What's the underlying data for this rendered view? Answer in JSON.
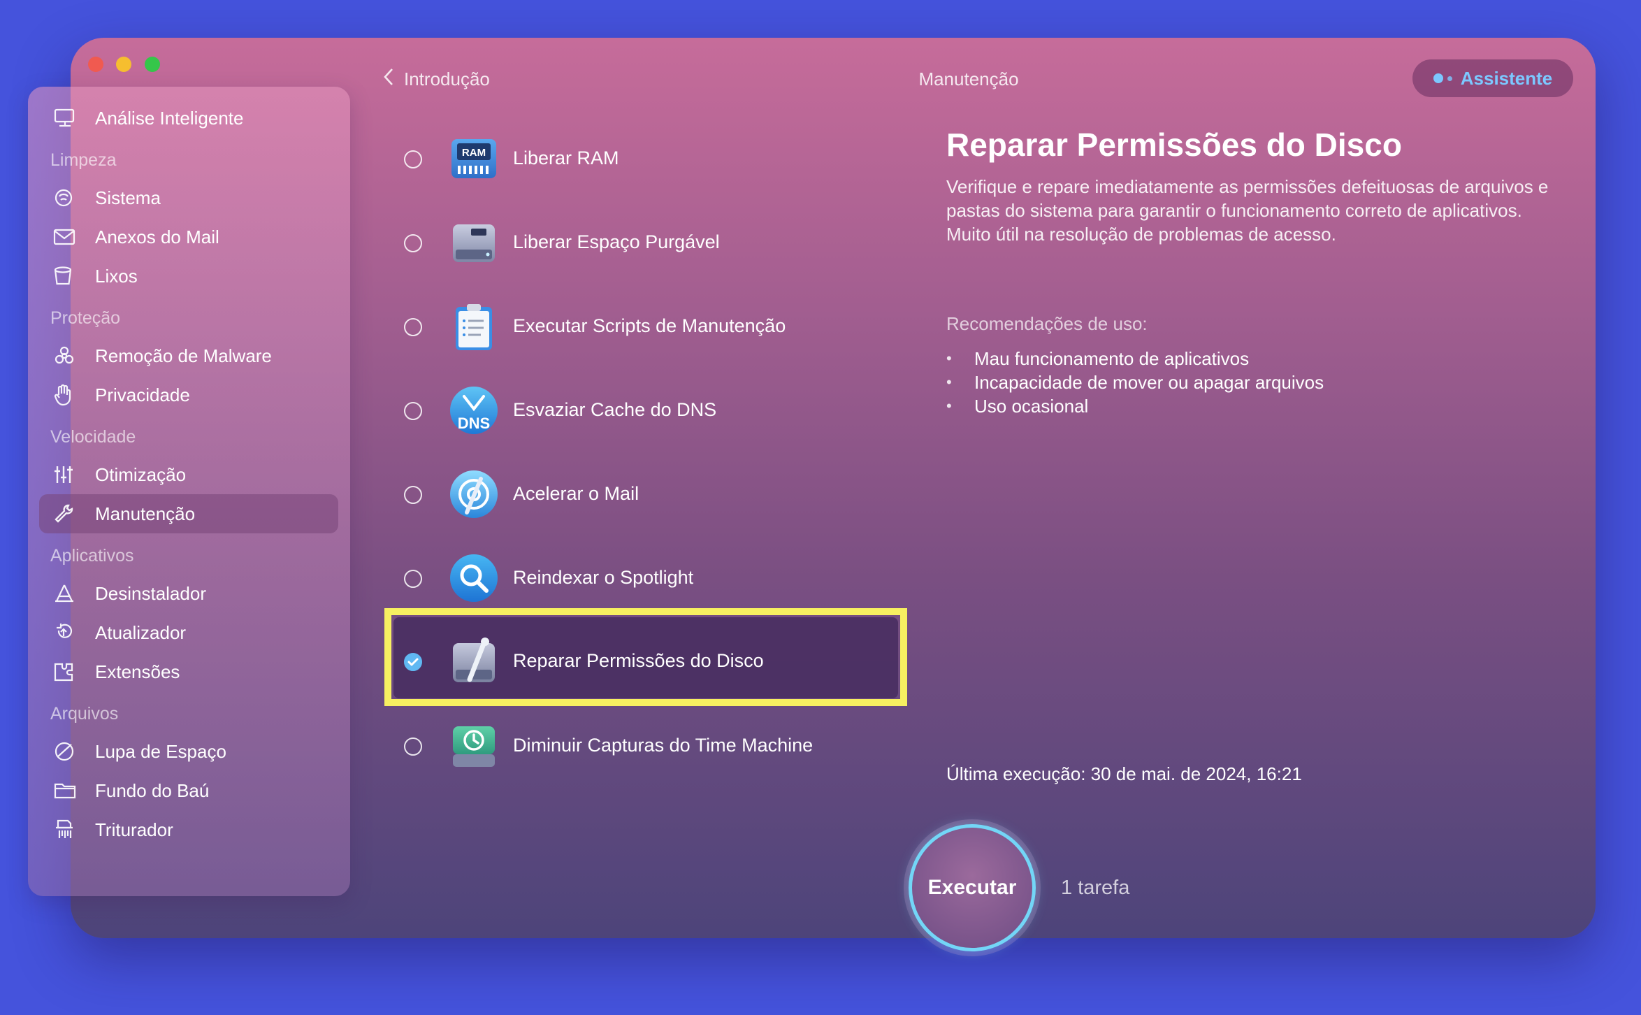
{
  "window": {
    "traffic_lights": [
      "close",
      "minimize",
      "zoom"
    ]
  },
  "sidebar": {
    "top_item": {
      "label": "Análise Inteligente",
      "icon": "monitor-icon"
    },
    "sections": [
      {
        "title": "Limpeza",
        "items": [
          {
            "label": "Sistema",
            "icon": "system-icon"
          },
          {
            "label": "Anexos do Mail",
            "icon": "envelope-icon"
          },
          {
            "label": "Lixos",
            "icon": "trash-icon"
          }
        ]
      },
      {
        "title": "Proteção",
        "items": [
          {
            "label": "Remoção de Malware",
            "icon": "biohazard-icon"
          },
          {
            "label": "Privacidade",
            "icon": "hand-icon"
          }
        ]
      },
      {
        "title": "Velocidade",
        "items": [
          {
            "label": "Otimização",
            "icon": "sliders-icon"
          },
          {
            "label": "Manutenção",
            "icon": "wrench-icon",
            "active": true
          }
        ]
      },
      {
        "title": "Aplicativos",
        "items": [
          {
            "label": "Desinstalador",
            "icon": "uninstaller-icon"
          },
          {
            "label": "Atualizador",
            "icon": "updater-icon"
          },
          {
            "label": "Extensões",
            "icon": "extensions-icon"
          }
        ]
      },
      {
        "title": "Arquivos",
        "items": [
          {
            "label": "Lupa de Espaço",
            "icon": "space-lens-icon"
          },
          {
            "label": "Fundo do Baú",
            "icon": "folder-icon"
          },
          {
            "label": "Triturador",
            "icon": "shredder-icon"
          }
        ]
      }
    ]
  },
  "nav": {
    "back_label": "Introdução",
    "title": "Manutenção",
    "assistant_label": "Assistente"
  },
  "tasks": [
    {
      "label": "Liberar RAM",
      "icon": "ram-icon",
      "icon_text": "RAM",
      "checked": false
    },
    {
      "label": "Liberar Espaço Purgável",
      "icon": "disk-icon",
      "checked": false
    },
    {
      "label": "Executar Scripts de Manutenção",
      "icon": "clipboard-icon",
      "checked": false
    },
    {
      "label": "Esvaziar Cache do DNS",
      "icon": "dns-icon",
      "icon_text": "DNS",
      "checked": false
    },
    {
      "label": "Acelerar o Mail",
      "icon": "mail-speed-icon",
      "checked": false
    },
    {
      "label": "Reindexar o Spotlight",
      "icon": "spotlight-icon",
      "checked": false
    },
    {
      "label": "Reparar Permissões do Disco",
      "icon": "disk-repair-icon",
      "checked": true,
      "selected": true
    },
    {
      "label": "Diminuir Capturas do Time Machine",
      "icon": "time-machine-icon",
      "checked": false
    }
  ],
  "detail": {
    "title": "Reparar Permissões do Disco",
    "description": "Verifique e repare imediatamente as permissões defeituosas de arquivos e pastas do sistema para garantir o funcionamento correto de aplicativos. Muito útil na resolução de problemas de acesso.",
    "recommendations_title": "Recomendações de uso:",
    "recommendations": [
      "Mau funcionamento de aplicativos",
      "Incapacidade de mover ou apagar arquivos",
      "Uso ocasional"
    ],
    "bullet": "•",
    "last_run_label": "Última execução:",
    "last_run_value": "30 de mai. de 2024, 16:21"
  },
  "footer": {
    "run_label": "Executar",
    "task_count": "1 tarefa"
  },
  "colors": {
    "background": "#4553dc",
    "highlight_box": "#f7f061",
    "accent_blue": "#60b8f2",
    "run_ring": "#73d6f7"
  }
}
